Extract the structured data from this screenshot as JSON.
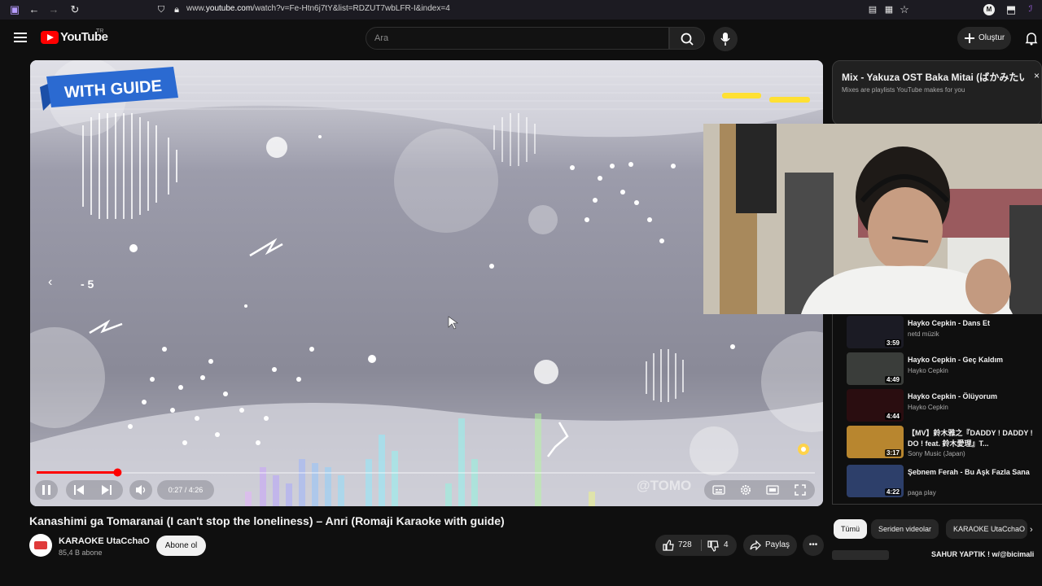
{
  "browser": {
    "url_prefix": "www.",
    "url_host": "youtube.com",
    "url_path": "/watch?v=Fe-Htn6j7tY&list=RDZUT7wbLFR-I&index=4",
    "profile_initial": "M"
  },
  "header": {
    "logo_text": "YouTube",
    "logo_region": "TR",
    "search_placeholder": "Ara",
    "create_label": "Oluştur"
  },
  "player": {
    "banner_text": "WITH GUIDE",
    "seek_back_label": "- 5",
    "time_display": "0:27 / 4:26",
    "watermark": "@TOMO",
    "progress": 0.104
  },
  "video": {
    "title": "Kanashimi ga Tomaranai (I can't stop the loneliness) – Anri (Romaji Karaoke with guide)",
    "channel_name": "KARAOKE UtaCchaO",
    "subscribers": "85,4 B abone",
    "subscribe_label": "Abone ol",
    "likes": "728",
    "dislikes": "4",
    "share_label": "Paylaş"
  },
  "mix": {
    "title": "Mix - Yakuza OST Baka Mitai (ばかみたい)",
    "subtitle": "Mixes are playlists YouTube makes for you"
  },
  "playlist": [
    {
      "title": "Hayko Cepkin - Dans Et",
      "channel": "netd müzik",
      "duration": "3:59",
      "color": "#1b1b24"
    },
    {
      "title": "Hayko Cepkin - Geç Kaldım",
      "channel": "Hayko Cepkin",
      "duration": "4:49",
      "color": "#3a3d3a"
    },
    {
      "title": "Hayko Cepkin - Ölüyorum",
      "channel": "Hayko Cepkin",
      "duration": "4:44",
      "color": "#2a0d10"
    },
    {
      "title": "【MV】鈴木雅之『DADDY ! DADDY ! DO ! feat. 鈴木愛理』T...",
      "channel": "Sony Music (Japan)",
      "duration": "3:17",
      "color": "#b8862f"
    },
    {
      "title": "Şebnem Ferah - Bu Aşk Fazla Sana",
      "channel": "paga play",
      "duration": "4:22",
      "color": "#2d3f6a"
    }
  ],
  "chips": [
    "Tümü",
    "Seriden videolar",
    "KARAOKE UtaCchaO"
  ],
  "next_item": {
    "title": "SAHUR YAPTIK ! w/@bicimali"
  }
}
